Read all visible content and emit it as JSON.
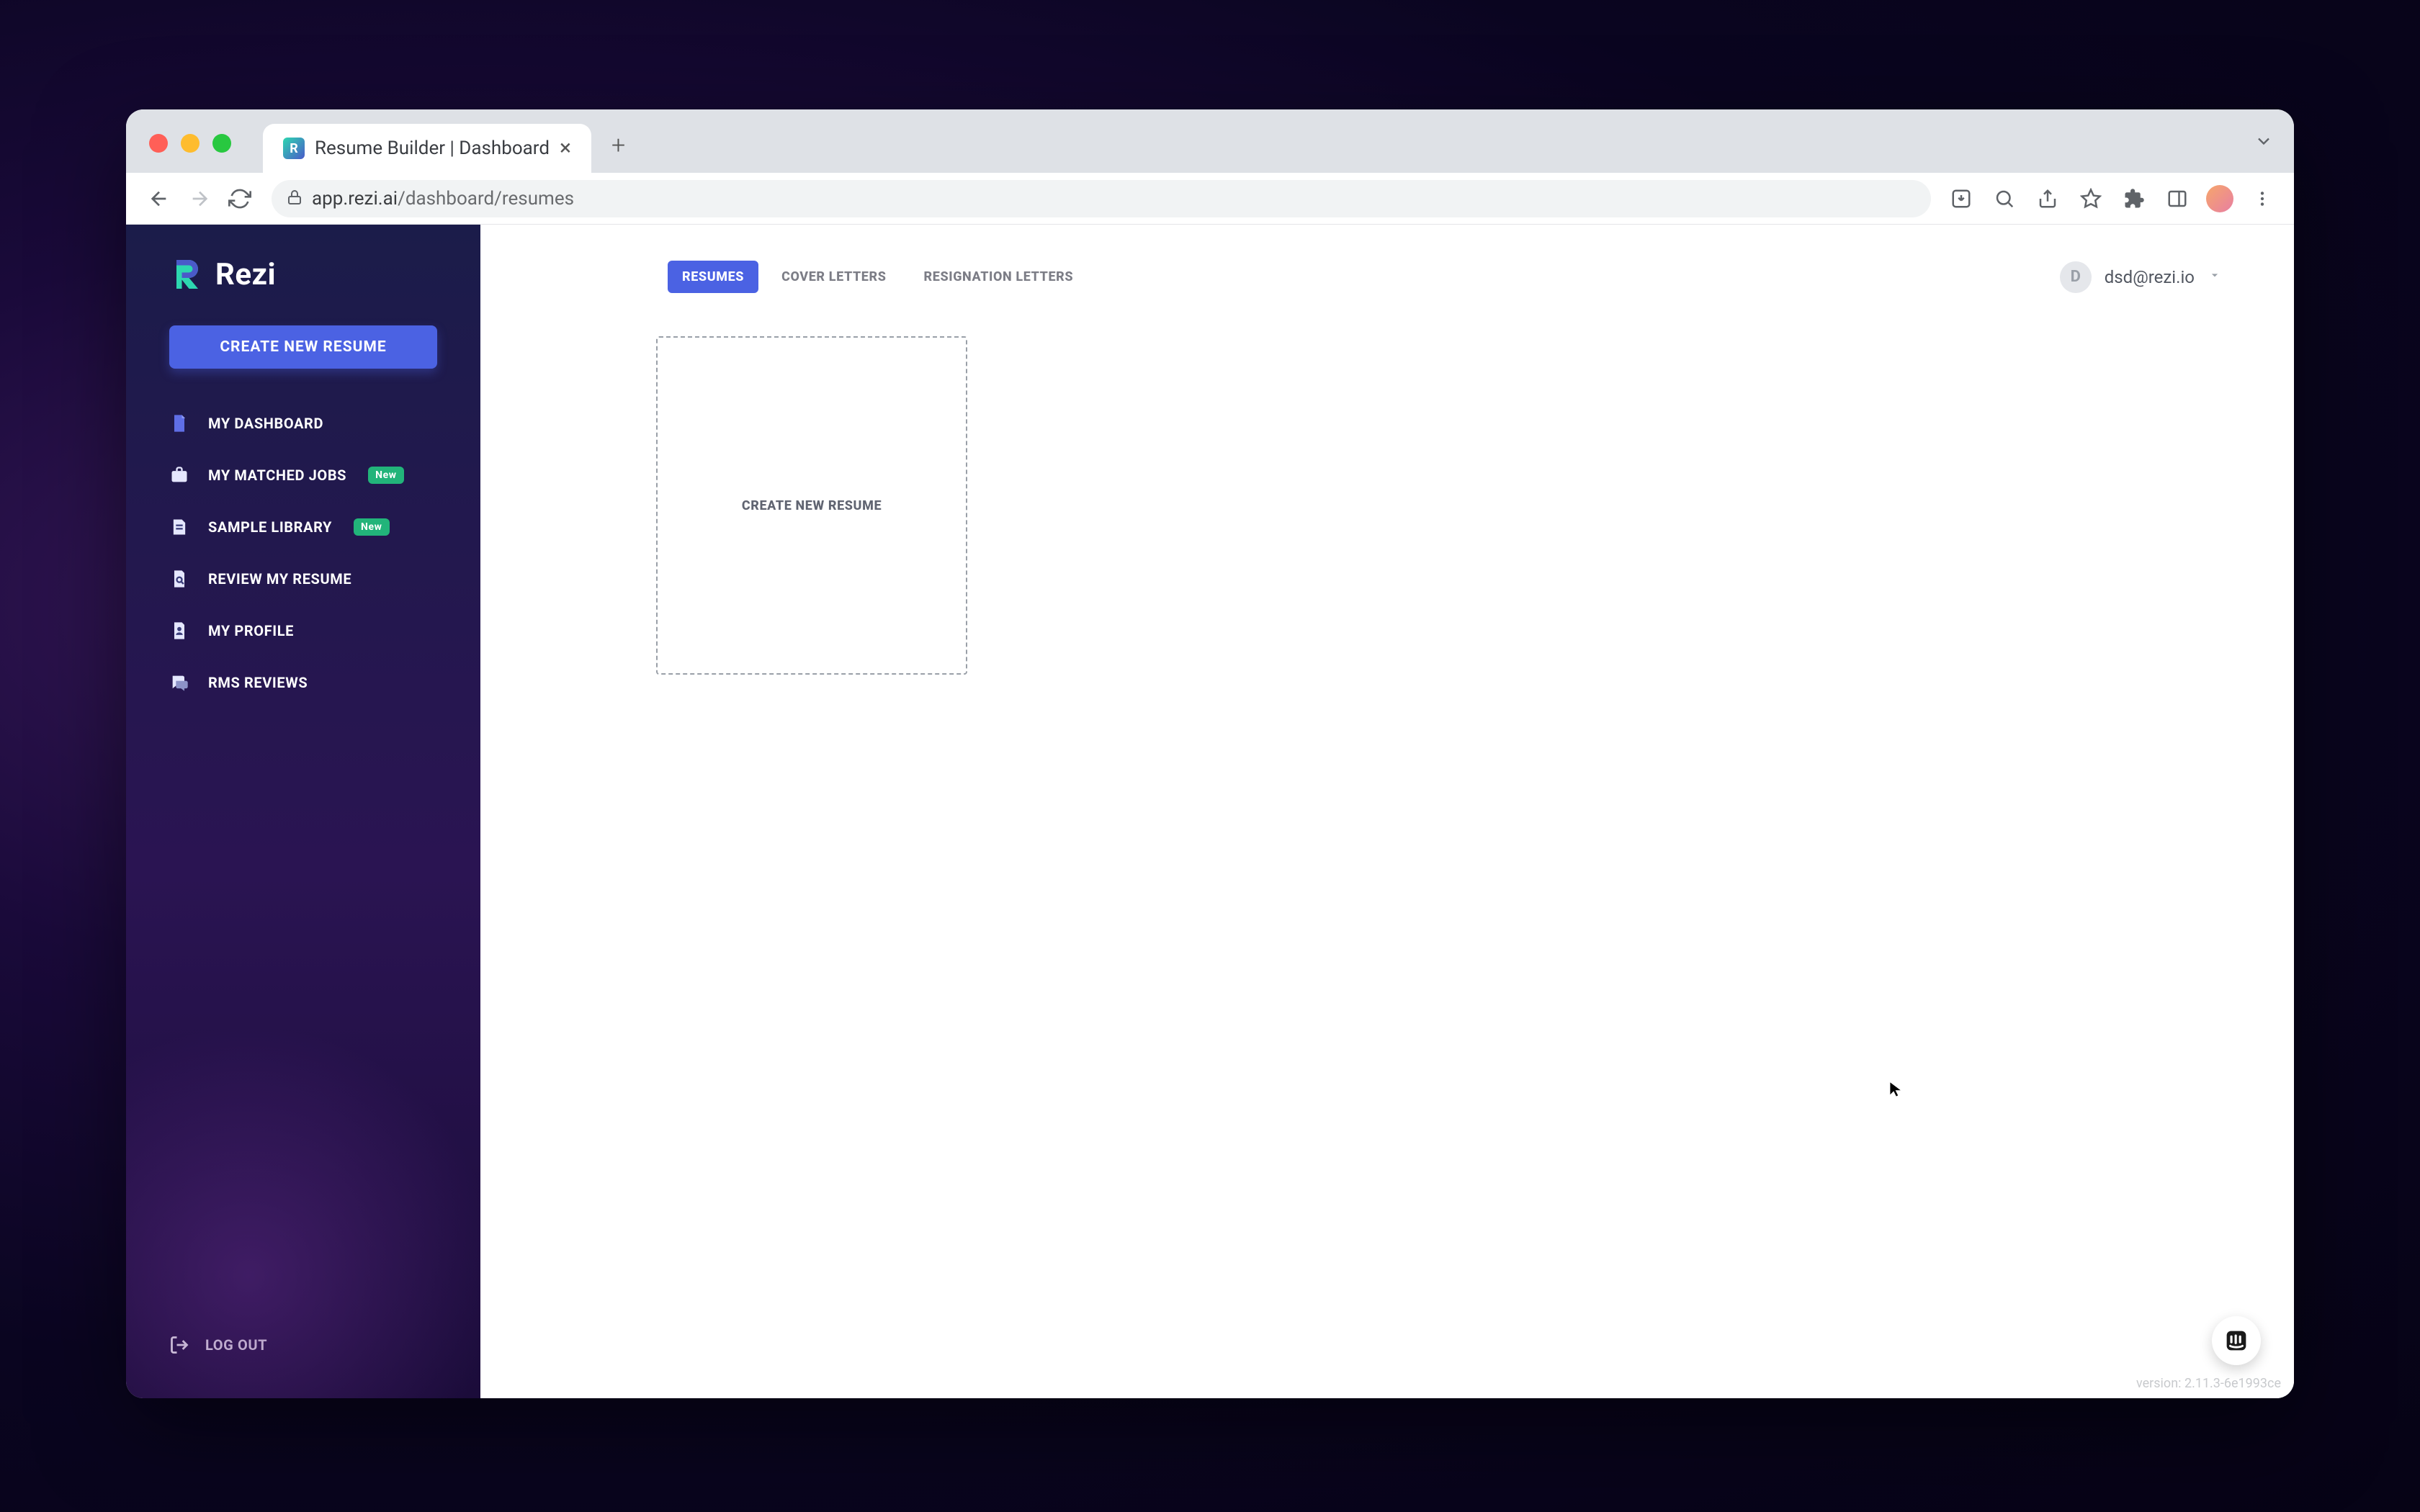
{
  "browser": {
    "tab_title": "Resume Builder | Dashboard",
    "url_host": "app.rezi.ai",
    "url_path": "/dashboard/resumes"
  },
  "sidebar": {
    "brand": "Rezi",
    "create_button": "CREATE NEW RESUME",
    "items": [
      {
        "label": "MY DASHBOARD"
      },
      {
        "label": "MY MATCHED JOBS",
        "badge": "New"
      },
      {
        "label": "SAMPLE LIBRARY",
        "badge": "New"
      },
      {
        "label": "REVIEW MY RESUME"
      },
      {
        "label": "MY PROFILE"
      },
      {
        "label": "RMS REVIEWS"
      }
    ],
    "logout": "LOG OUT"
  },
  "tabs": [
    {
      "label": "RESUMES",
      "active": true
    },
    {
      "label": "COVER LETTERS",
      "active": false
    },
    {
      "label": "RESIGNATION LETTERS",
      "active": false
    }
  ],
  "user": {
    "initial": "D",
    "email": "dsd@rezi.io"
  },
  "card": {
    "create_label": "CREATE NEW RESUME"
  },
  "footer": {
    "version": "version: 2.11.3-6e1993ce"
  }
}
